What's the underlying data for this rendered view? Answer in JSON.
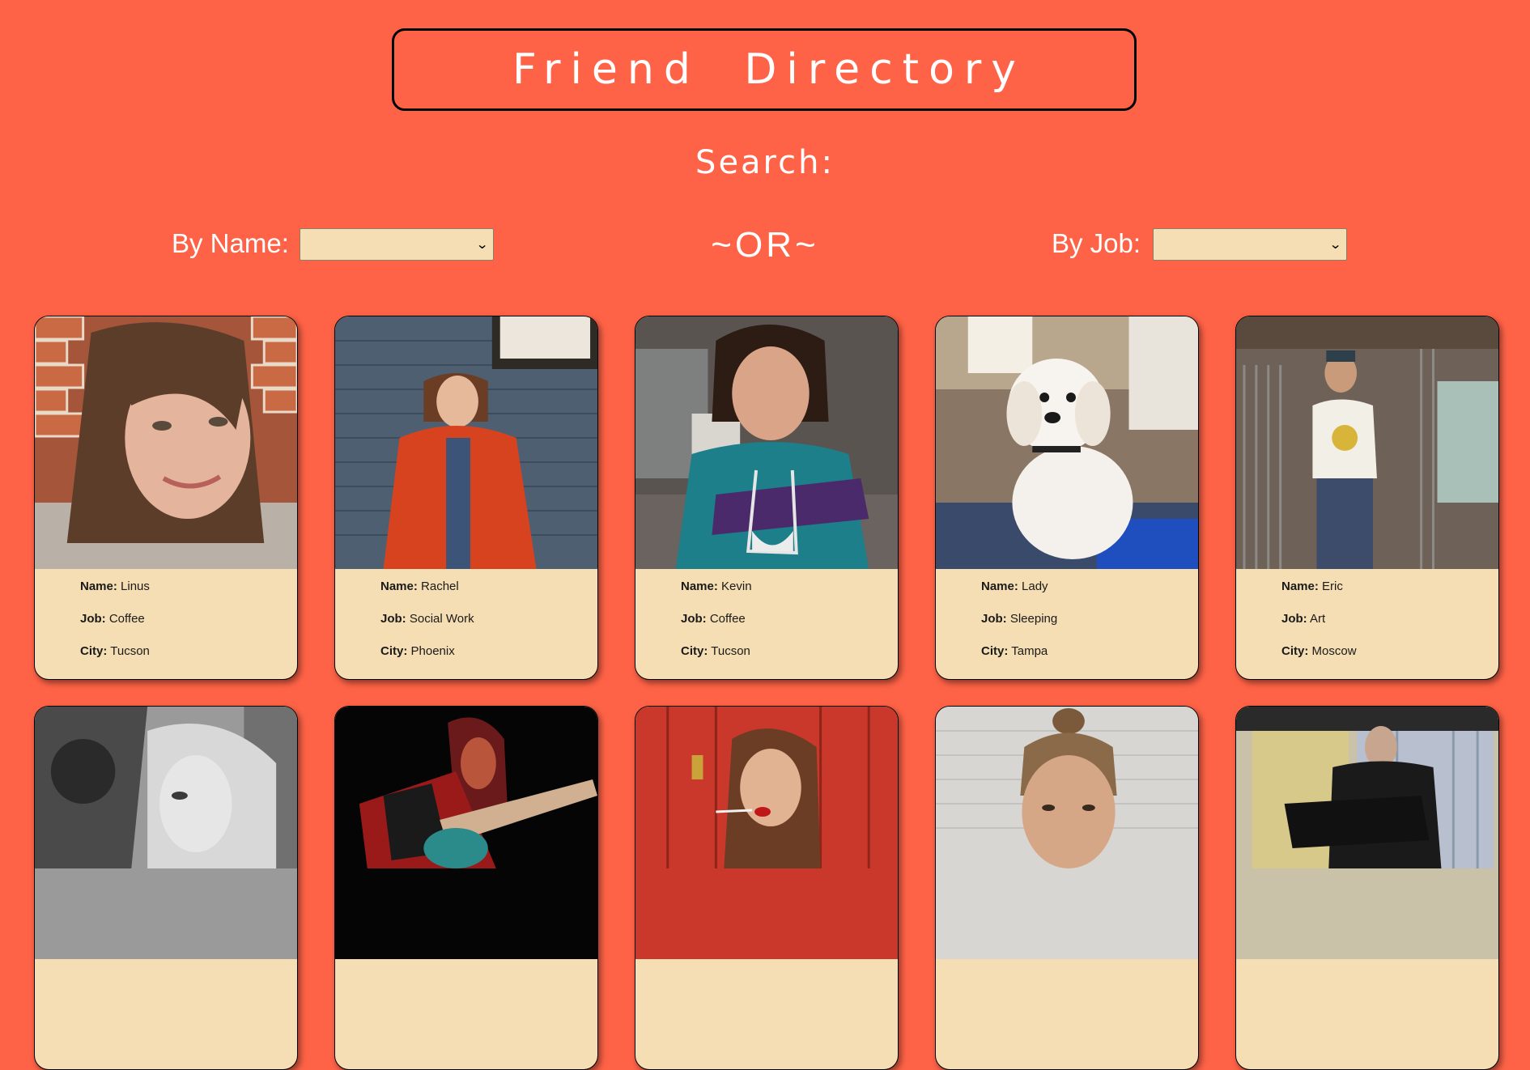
{
  "header": {
    "title": "Friend Directory"
  },
  "search": {
    "label": "Search:",
    "by_name_label": "By Name:",
    "or_text": "~OR~",
    "by_job_label": "By Job:",
    "by_name_value": "",
    "by_job_value": ""
  },
  "field_labels": {
    "name": "Name:",
    "job": "Job:",
    "city": "City:"
  },
  "cards": [
    {
      "name": "Linus",
      "job": "Coffee",
      "city": "Tucson",
      "photo": "woman-brick-wall-photo"
    },
    {
      "name": "Rachel",
      "job": "Social Work",
      "city": "Phoenix",
      "photo": "woman-red-coat-photo"
    },
    {
      "name": "Kevin",
      "job": "Coffee",
      "city": "Tucson",
      "photo": "man-curly-hair-photo"
    },
    {
      "name": "Lady",
      "job": "Sleeping",
      "city": "Tampa",
      "photo": "white-dog-photo"
    },
    {
      "name": "Eric",
      "job": "Art",
      "city": "Moscow",
      "photo": "man-standing-warehouse-photo"
    },
    {
      "photo": "woman-black-white-photo"
    },
    {
      "photo": "guitarist-stage-photo"
    },
    {
      "photo": "woman-lockers-photo"
    },
    {
      "photo": "man-bun-photo"
    },
    {
      "photo": "man-music-stand-photo"
    }
  ],
  "colors": {
    "background": "#ff6347",
    "card": "#f5deb3",
    "select": "#f5deb3"
  }
}
